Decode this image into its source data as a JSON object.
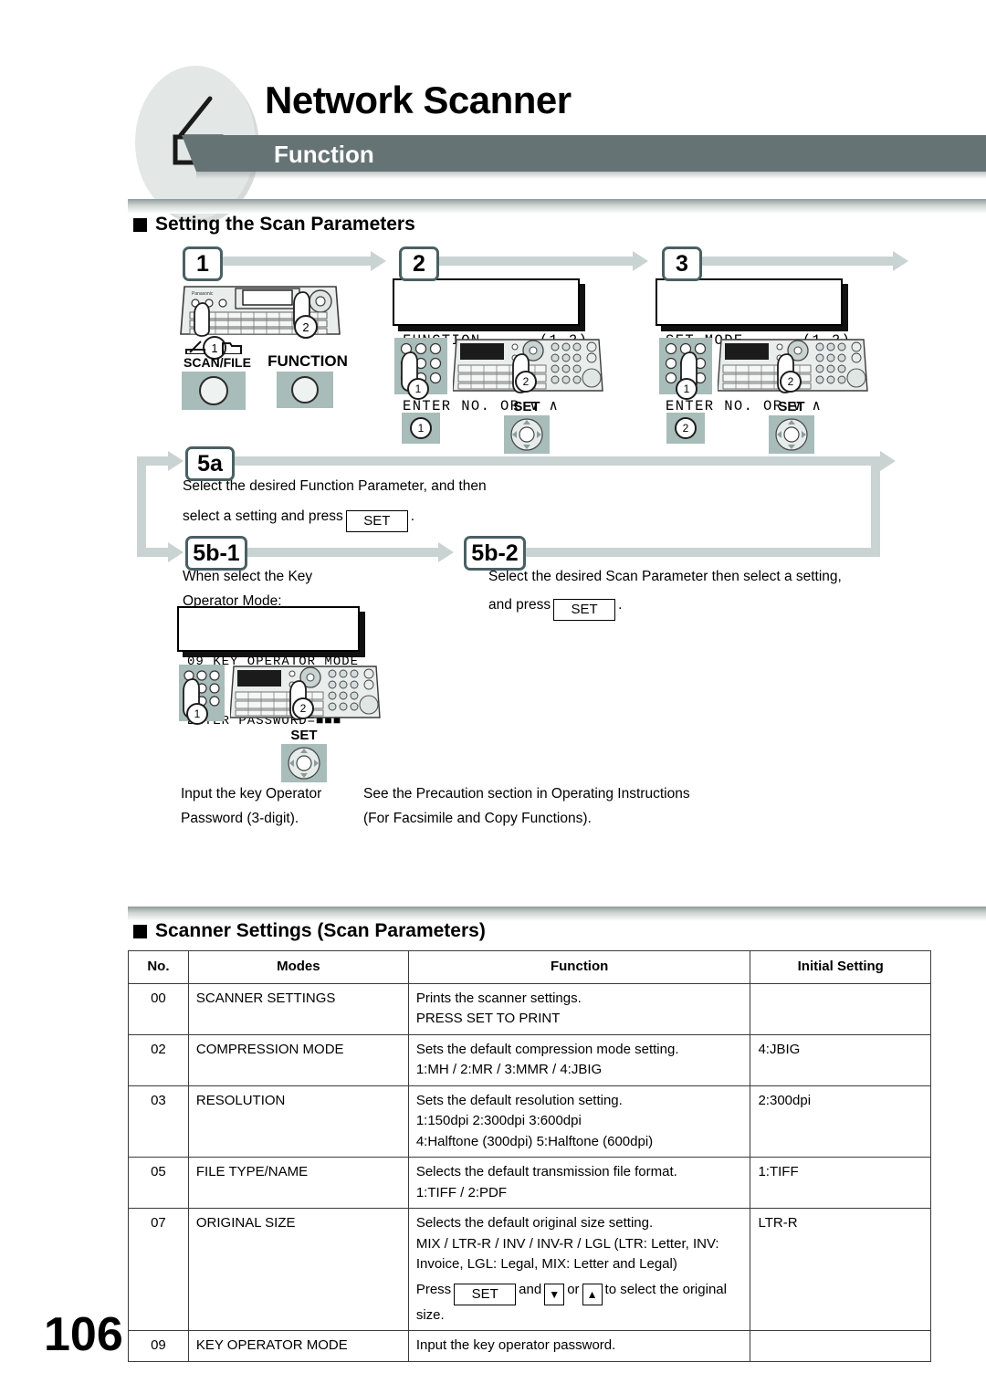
{
  "page": {
    "number": "106",
    "title": "Network Scanner",
    "subtitle": "Function",
    "icon": "scanner-icon"
  },
  "colors": {
    "header_bar": "#667374",
    "step_border": "#4a6063",
    "arrow": "#c9d3d2",
    "key_bg": "#a8bcb9",
    "ellipse": "#e3e8e6"
  },
  "sections": {
    "procedure": {
      "heading": "Setting the Scan Parameters"
    },
    "table": {
      "heading": "Scanner Settings (Scan Parameters)"
    }
  },
  "steps": {
    "s1": {
      "label": "1",
      "key_scanfile_caption": "SCAN/FILE",
      "key_function_caption": "FUNCTION",
      "marker_1": "①",
      "marker_2": "②"
    },
    "s2": {
      "label": "2",
      "lcd_line1": "FUNCTION      (1-2)",
      "lcd_line2": "ENTER NO. OR ∨ ∧",
      "keypad_digit": "①",
      "set_caption": "SET",
      "marker_1": "①",
      "marker_2": "②"
    },
    "s3": {
      "label": "3",
      "lcd_line1": "SET MODE      (1-2)",
      "lcd_line2": "ENTER NO. OR ∨ ∧",
      "keypad_digit": "②",
      "set_caption": "SET",
      "marker_1": "①",
      "marker_2": "②"
    },
    "s5a": {
      "label": "5a",
      "text_line1": "Select the desired Function Parameter, and then",
      "text_line2_pre": "select a setting and press",
      "set_label": "SET",
      "text_line2_post": "."
    },
    "s5b1": {
      "label": "5b-1",
      "text_line1": "When select the Key",
      "text_line2": "Operator Mode:",
      "lcd_line1": "09 KEY OPERATOR MODE",
      "lcd_line2": "ENTER PASSWORD=■■■",
      "set_caption": "SET",
      "marker_1": "①",
      "marker_2": "②",
      "footnote_line1": "Input the key Operator",
      "footnote_line2": "Password (3-digit)."
    },
    "s5b2": {
      "label": "5b-2",
      "text_line1": "Select the desired Scan Parameter then select a setting,",
      "text_line2_pre": "and press",
      "set_label": "SET",
      "text_line2_post": ".",
      "footnote_line1": "See the Precaution section in Operating Instructions",
      "footnote_line2": "(For Facsimile and Copy Functions)."
    }
  },
  "table": {
    "headers": [
      "No.",
      "Modes",
      "Function",
      "Initial Setting"
    ],
    "rows": [
      {
        "no": "00",
        "mode": "SCANNER SETTINGS",
        "function": [
          "Prints the scanner settings.",
          "PRESS SET TO PRINT"
        ],
        "initial": ""
      },
      {
        "no": "02",
        "mode": "COMPRESSION MODE",
        "function": [
          "Sets the default compression mode setting.",
          "1:MH / 2:MR / 3:MMR / 4:JBIG"
        ],
        "initial": "4:JBIG"
      },
      {
        "no": "03",
        "mode": "RESOLUTION",
        "function": [
          "Sets the default resolution setting.",
          "1:150dpi 2:300dpi 3:600dpi",
          "4:Halftone (300dpi) 5:Halftone (600dpi)"
        ],
        "initial": "2:300dpi"
      },
      {
        "no": "05",
        "mode": "FILE TYPE/NAME",
        "function": [
          "Selects the default transmission file format.",
          "1:TIFF / 2:PDF"
        ],
        "initial": "1:TIFF"
      },
      {
        "no": "07",
        "mode": "ORIGINAL SIZE",
        "function": [
          "Selects the default original size setting.",
          "MIX / LTR-R / INV / INV-R / LGL (LTR: Letter, INV:",
          "Invoice, LGL: Legal, MIX: Letter and Legal)"
        ],
        "function_press": {
          "pre": "Press",
          "set_label": "SET",
          "mid": "and",
          "down_icon": "▼",
          "or": "or",
          "up_icon": "▲",
          "post": "to select the original",
          "tail": "size."
        },
        "initial": "LTR-R"
      },
      {
        "no": "09",
        "mode": "KEY OPERATOR MODE",
        "function": [
          "Input the key operator password."
        ],
        "initial": ""
      }
    ]
  }
}
